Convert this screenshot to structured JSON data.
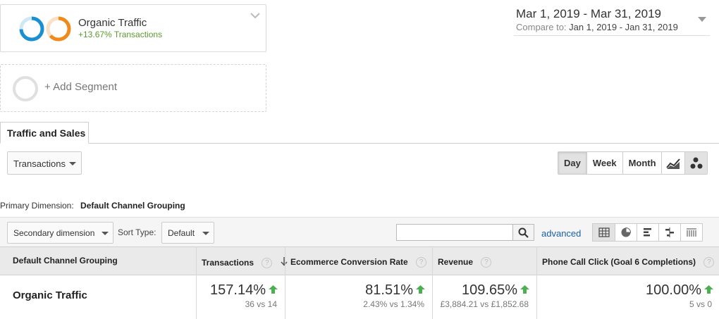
{
  "segment": {
    "name": "Organic Traffic",
    "change": "+13.67% Transactions"
  },
  "add_segment": {
    "label": "+ Add Segment"
  },
  "date_range": {
    "main": "Mar 1, 2019 - Mar 31, 2019",
    "compare_label": "Compare to:",
    "compare_range": "Jan 1, 2019 - Jan 31, 2019"
  },
  "tabs": {
    "active": "Traffic and Sales"
  },
  "metric_selector": {
    "value": "Transactions"
  },
  "period": {
    "day": "Day",
    "week": "Week",
    "month": "Month",
    "selected": "Day"
  },
  "chart_type": {
    "icons": [
      "line-chart-icon",
      "motion-chart-icon"
    ],
    "selected": "motion-chart-icon"
  },
  "primary_dimension": {
    "label": "Primary Dimension:",
    "value": "Default Channel Grouping"
  },
  "toolbar": {
    "secondary_dimension": "Secondary dimension",
    "sort_type_label": "Sort Type:",
    "sort_type_value": "Default",
    "search_placeholder": "",
    "advanced": "advanced",
    "views": [
      "table-view-icon",
      "pie-view-icon",
      "performance-view-icon",
      "comparison-view-icon",
      "pivot-view-icon"
    ]
  },
  "table": {
    "headers": {
      "dimension": "Default Channel Grouping",
      "transactions": "Transactions",
      "conversion": "Ecommerce Conversion Rate",
      "revenue": "Revenue",
      "goal": "Phone Call Click (Goal 6 Completions)"
    },
    "row": {
      "label": "Organic Traffic",
      "transactions": {
        "value": "157.14%",
        "sub": "36 vs 14"
      },
      "conversion": {
        "value": "81.51%",
        "sub": "2.43% vs 1.34%"
      },
      "revenue": {
        "value": "109.65%",
        "sub": "£3,884.21 vs £1,852.68"
      },
      "goal": {
        "value": "100.00%",
        "sub": "5 vs 0"
      }
    }
  },
  "colors": {
    "ring_blue": "#1a8fd1",
    "ring_orange": "#f08a1a",
    "positive": "#5a9a2e",
    "up_arrow": "#4caf50",
    "link": "#1a5fa8"
  }
}
